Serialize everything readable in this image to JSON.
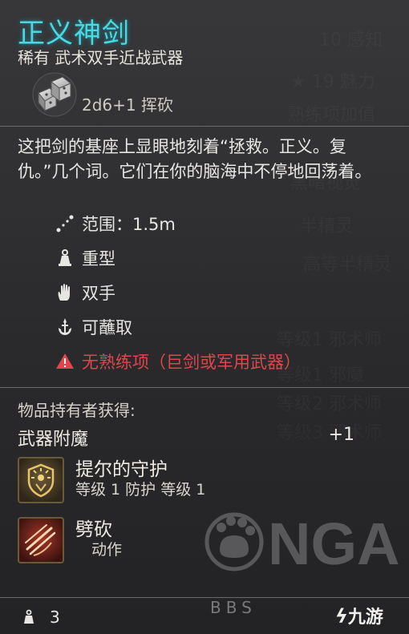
{
  "item": {
    "name": "正义神剑",
    "subtitle": "稀有 武术双手近战武器",
    "damage": "2d6+1 挥砍",
    "description": "这把剑的基座上显眼地刻着“拯救。正义。复仇。”几个词。它们在你的脑海中不停地回荡着。",
    "properties": [
      {
        "icon": "range-icon",
        "label": "范围：1.5m"
      },
      {
        "icon": "heavy-weight-icon",
        "label": "重型"
      },
      {
        "icon": "hand-icon",
        "label": "双手"
      },
      {
        "icon": "dip-icon",
        "label": "可蘸取"
      },
      {
        "icon": "warning-icon",
        "label": "无熟练项（巨剑或军用武器）"
      }
    ],
    "owner_gains_label": "物品持有者获得:",
    "enchant": {
      "label": "武器附魔",
      "value": "+1"
    },
    "abilities": [
      {
        "icon": "shield-sun-icon",
        "name": "提尔的守护",
        "meta": "等级 1  防护  等级 1"
      },
      {
        "icon": "claw-slash-icon",
        "name": "劈砍",
        "meta": "动作"
      }
    ],
    "weight": "3"
  },
  "watermark": {
    "bbs": "BBS",
    "nga": "NGA",
    "jiuyou": "九游"
  },
  "colors": {
    "title": "#4fd7df",
    "warning": "#e0464b"
  }
}
